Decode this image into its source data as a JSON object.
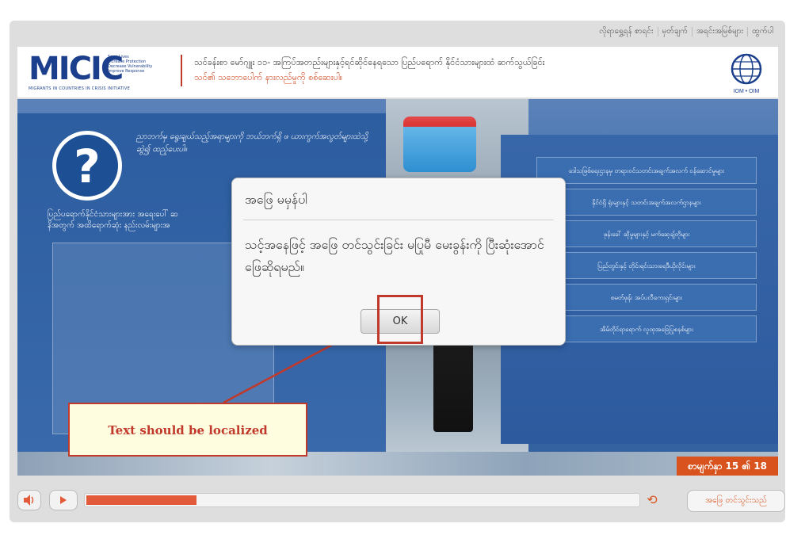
{
  "topnav": [
    "လိုရာရွှေ့ရန် စာရင်း",
    "မှတ်ချက်",
    "အရင်းအမြစ်များ",
    "ထွက်ပါ"
  ],
  "logo": {
    "name": "MICIC",
    "tagline_lines": [
      "Save Lives",
      "Increase Protection",
      "Decrease Vulnerability",
      "Improve Response"
    ],
    "subtitle": "MIGRANTS IN COUNTRIES IN CRISIS INITIATIVE",
    "partner": "IOM • OIM"
  },
  "header": {
    "title": "သင်ခန်းစာ မော်ဂျူး ၁၁- အကြပ်အတည်းများနှင့်ရင်ဆိုင်နေရသော ပြည်ပရောက် နိုင်ငံသားများထံ ဆက်သွယ်ခြင်း",
    "subtitle": "သင်၏ သဘောပေါက် နားလည်မှုကို စစ်ဆေးပါ။"
  },
  "left_panel": {
    "question_prompt": "ညာဘက်မှ ရွေးချယ်သည့်အရာများကို ဘယ်ဘက်ရှိ ဖ ယားကွက်အလွတ်များထဲသို့ ဆွဲ၍ ထည့်ပေးပါ။",
    "intro_line1": "ပြည်ပရောက်နိုင်ငံသားများအား အရေးပေါ် ဆ",
    "intro_line2": "နိအတွက် အထိရောက်ဆုံး နည်းလမ်းများအ"
  },
  "menu_items": [
    "ဒေါသဖြစ်ရေးဌာနမှ တရားဝင်သတင်းအချက်အလက် ဝန်ဆောင်မှုများ",
    "နိုင်ငံရှိ ရုံးများနှင့် သတင်းအချက်အလက်ဌာနများ",
    "ဖုန်းခေါ် ဆိုမှုများနှင့် မက်ဆေ့ချ်တိုများ",
    "ပြည်တွင်းနှင့် တိုင်းရင်းသားရေဒီယိုလိုင်းများ",
    "စမတ်ဖုန်း အပ်ပလီကေးရှင်းများ",
    "အိမ်တိုင်ရာရောက် လူထုအခြေပြုစနစ်များ"
  ],
  "page_indicator": "စာမျက်နှာ 15 ၏ 18",
  "dialog": {
    "title": "အဖြေ မမှန်ပါ",
    "message": "သင့်အနေဖြင့် အဖြေ တင်သွင်းခြင်း မပြုမီ မေးခွန်းကို ပြီးဆုံးအောင် ဖြေဆိုရမည်။",
    "ok_label": "OK"
  },
  "annotation": {
    "text": "Text should be localized"
  },
  "controls": {
    "progress_fraction": 0.2,
    "submit_label": "အဖြေ တင်သွင်းသည်"
  },
  "colors": {
    "accent": "#d9531e",
    "brand_blue": "#1b3f8c",
    "annotation_red": "#c0392b"
  },
  "icons": [
    "volume-icon",
    "play-icon",
    "reload-icon",
    "question-icon"
  ]
}
